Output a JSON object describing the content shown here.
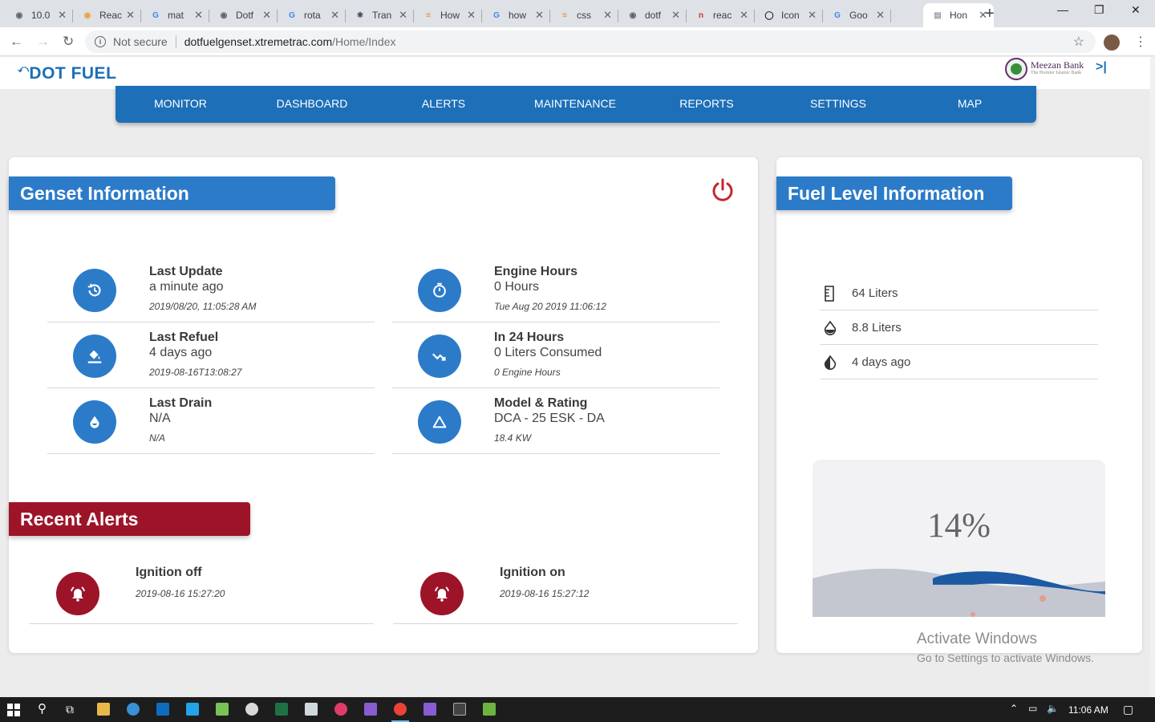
{
  "browser": {
    "tabs": [
      {
        "title": "10.0",
        "fav_color": "#5f6368",
        "fav_char": "◉"
      },
      {
        "title": "Reac",
        "fav_color": "#e8a33d",
        "fav_char": "◉"
      },
      {
        "title": "mat",
        "fav_color": "#4285f4",
        "fav_char": "G"
      },
      {
        "title": "Dotf",
        "fav_color": "#5f6368",
        "fav_char": "◉"
      },
      {
        "title": "rota",
        "fav_color": "#4285f4",
        "fav_char": "G"
      },
      {
        "title": "Tran",
        "fav_color": "#1e2b3a",
        "fav_char": "⚛"
      },
      {
        "title": "How",
        "fav_color": "#f48024",
        "fav_char": "≡"
      },
      {
        "title": "how",
        "fav_color": "#4285f4",
        "fav_char": "G"
      },
      {
        "title": "css",
        "fav_color": "#f48024",
        "fav_char": "≡"
      },
      {
        "title": "dotf",
        "fav_color": "#5f6368",
        "fav_char": "◉"
      },
      {
        "title": "reac",
        "fav_color": "#cb3837",
        "fav_char": "n"
      },
      {
        "title": "Icon",
        "fav_color": "#222222",
        "fav_char": "◯"
      },
      {
        "title": "Goo",
        "fav_color": "#4285f4",
        "fav_char": "G"
      },
      {
        "title": "Hon",
        "fav_color": "#9aa0a6",
        "fav_char": "▤"
      }
    ],
    "new_tab": "+",
    "security_label": "Not secure",
    "url_host": "dotfuelgenset.xtremetrac.com",
    "url_path": "/Home/Index"
  },
  "header": {
    "logo_text": "DOT FUEL",
    "bank_name": "Meezan Bank",
    "bank_tagline": "The Premier Islamic Bank",
    "collapse_glyph": ">|"
  },
  "nav": {
    "items": [
      "MONITOR",
      "DASHBOARD",
      "ALERTS",
      "MAINTENANCE",
      "REPORTS",
      "SETTINGS",
      "MAP"
    ]
  },
  "genset": {
    "title": "Genset Information",
    "items": [
      {
        "icon": "history-icon",
        "title": "Last Update",
        "value": "a minute ago",
        "sub": "2019/08/20, 11:05:28 AM"
      },
      {
        "icon": "timer-icon",
        "title": "Engine Hours",
        "value": "0 Hours",
        "sub": "Tue Aug 20 2019 11:06:12"
      },
      {
        "icon": "paint-bucket-icon",
        "title": "Last Refuel",
        "value": "4 days ago",
        "sub": "2019-08-16T13:08:27"
      },
      {
        "icon": "trend-down-icon",
        "title": "In 24 Hours",
        "value": "0 Liters Consumed",
        "sub": "0 Engine Hours"
      },
      {
        "icon": "drop-icon",
        "title": "Last Drain",
        "value": "N/A",
        "sub": "N/A"
      },
      {
        "icon": "triangle-icon",
        "title": "Model & Rating",
        "value": "DCA - 25 ESK - DA",
        "sub": "18.4 KW"
      }
    ]
  },
  "alerts": {
    "title": "Recent Alerts",
    "items": [
      {
        "title": "Ignition off",
        "time": "2019-08-16 15:27:20"
      },
      {
        "title": "Ignition on",
        "time": "2019-08-16 15:27:12"
      }
    ]
  },
  "fuel": {
    "title": "Fuel Level Information",
    "rows": [
      {
        "icon": "ruler-icon",
        "text": "64 Liters"
      },
      {
        "icon": "drop-outline-icon",
        "text": "8.8 Liters"
      },
      {
        "icon": "contrast-drop-icon",
        "text": "4 days ago"
      }
    ],
    "level_percent": 14,
    "level_label": "14%"
  },
  "watermark": {
    "line1": "Activate Windows",
    "line2": "Go to Settings to activate Windows."
  },
  "taskbar": {
    "time": "11:06 AM"
  },
  "colors": {
    "brand_blue": "#2c7bc9",
    "nav_blue": "#1d6fb8",
    "alert_red": "#9d1429",
    "power_red": "#c1272d"
  }
}
